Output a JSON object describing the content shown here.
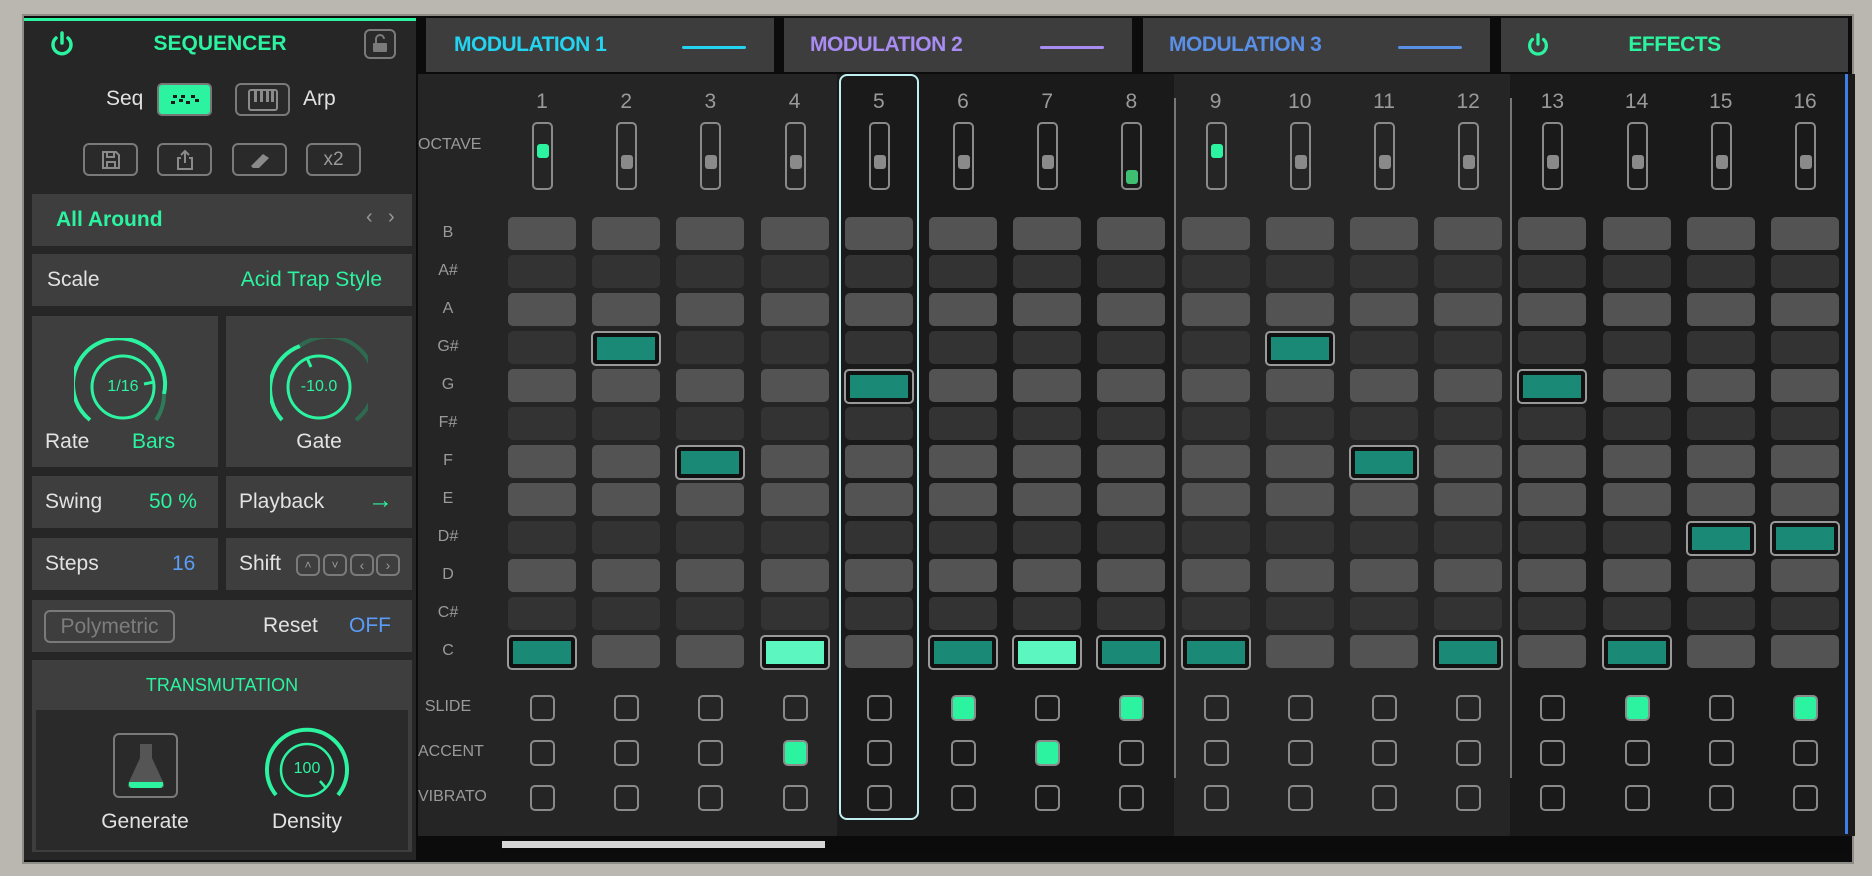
{
  "sequencer": {
    "title": "SEQUENCER",
    "seq_label": "Seq",
    "arp_label": "Arp",
    "x2_label": "x2",
    "preset": "All Around",
    "scale_label": "Scale",
    "scale_value": "Acid Trap Style",
    "rate_value": "1/16",
    "rate_label": "Rate",
    "rate_unit": "Bars",
    "gate_value": "-10.0",
    "gate_label": "Gate",
    "swing_label": "Swing",
    "swing_value": "50 %",
    "playback_label": "Playback",
    "playback_value": "→",
    "steps_label": "Steps",
    "steps_value": "16",
    "shift_label": "Shift",
    "polymetric_label": "Polymetric",
    "reset_label": "Reset",
    "reset_value": "OFF",
    "transmutation_title": "TRANSMUTATION",
    "generate_label": "Generate",
    "density_value": "100",
    "density_label": "Density"
  },
  "tabs": [
    {
      "label": "MODULATION 1",
      "color": "#23d3f0"
    },
    {
      "label": "MODULATION 2",
      "color": "#a88cf2"
    },
    {
      "label": "MODULATION 3",
      "color": "#5a8fe6"
    },
    {
      "label": "EFFECTS",
      "color": "#2cf3a0"
    }
  ],
  "grid": {
    "octave_label": "OCTAVE",
    "slide_label": "SLIDE",
    "accent_label": "ACCENT",
    "vibrato_label": "VIBRATO",
    "notes": [
      "B",
      "A#",
      "A",
      "G#",
      "G",
      "F#",
      "F",
      "E",
      "D#",
      "D",
      "C#",
      "C"
    ],
    "playhead_step": 5,
    "steps": [
      {
        "n": "1",
        "note": "C",
        "oct": "high",
        "slide": false,
        "accent": false,
        "vibrato": false,
        "bright": false
      },
      {
        "n": "2",
        "note": "G#",
        "oct": "mid",
        "slide": false,
        "accent": false,
        "vibrato": false,
        "bright": false
      },
      {
        "n": "3",
        "note": "F",
        "oct": "mid",
        "slide": false,
        "accent": false,
        "vibrato": false,
        "bright": false
      },
      {
        "n": "4",
        "note": "C",
        "oct": "mid",
        "slide": false,
        "accent": true,
        "vibrato": false,
        "bright": true
      },
      {
        "n": "5",
        "note": "G",
        "oct": "mid",
        "slide": false,
        "accent": false,
        "vibrato": false,
        "bright": false
      },
      {
        "n": "6",
        "note": "C",
        "oct": "mid",
        "slide": true,
        "accent": false,
        "vibrato": false,
        "bright": false
      },
      {
        "n": "7",
        "note": "C",
        "oct": "mid",
        "slide": false,
        "accent": true,
        "vibrato": false,
        "bright": true
      },
      {
        "n": "8",
        "note": "C",
        "oct": "low",
        "slide": true,
        "accent": false,
        "vibrato": false,
        "bright": false
      },
      {
        "n": "9",
        "note": "C",
        "oct": "high",
        "slide": false,
        "accent": false,
        "vibrato": false,
        "bright": false
      },
      {
        "n": "10",
        "note": "G#",
        "oct": "mid",
        "slide": false,
        "accent": false,
        "vibrato": false,
        "bright": false
      },
      {
        "n": "11",
        "note": "F",
        "oct": "mid",
        "slide": false,
        "accent": false,
        "vibrato": false,
        "bright": false
      },
      {
        "n": "12",
        "note": "C",
        "oct": "mid",
        "slide": false,
        "accent": false,
        "vibrato": false,
        "bright": false
      },
      {
        "n": "13",
        "note": "G",
        "oct": "mid",
        "slide": false,
        "accent": false,
        "vibrato": false,
        "bright": false
      },
      {
        "n": "14",
        "note": "C",
        "oct": "mid",
        "slide": true,
        "accent": false,
        "vibrato": false,
        "bright": false
      },
      {
        "n": "15",
        "note": "D#",
        "oct": "mid",
        "slide": false,
        "accent": false,
        "vibrato": false,
        "bright": false
      },
      {
        "n": "16",
        "note": "D#",
        "oct": "mid",
        "slide": true,
        "accent": false,
        "vibrato": false,
        "bright": false
      }
    ],
    "scroll_position": 0.24
  },
  "colors": {
    "accent": "#2cf3a0",
    "note_on": "#1a8a76",
    "note_bright": "#5cf7c0",
    "blue": "#5a9cf6"
  }
}
